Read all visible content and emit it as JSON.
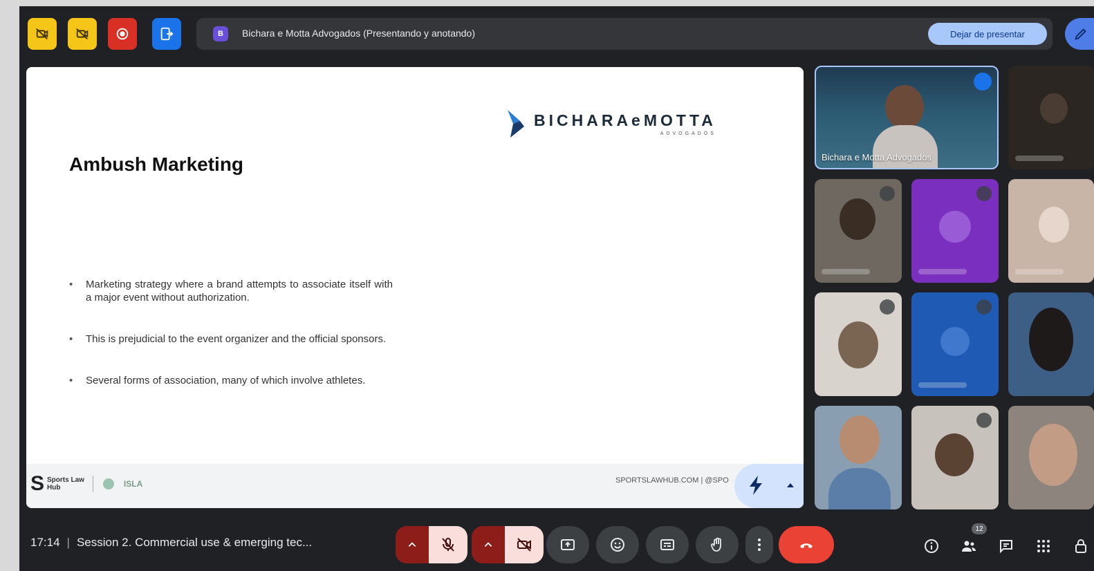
{
  "top_bar": {
    "present_badge": "B",
    "presenting_text": "Bichara e Motta Advogados (Presentando y anotando)",
    "stop_presenting_label": "Dejar de presentar",
    "colors": {
      "yellow": "#f5c518",
      "red": "#d93025",
      "blue": "#1a73e8",
      "stop_btn": "#a8c7fa"
    }
  },
  "slide": {
    "logo_name": "BICHARAeMOTTA",
    "logo_sub": "ADVOGADOS",
    "title": "Ambush Marketing",
    "bullets": [
      "Marketing strategy where a brand attempts to associate itself with a major event without authorization.",
      "This is prejudicial to the event organizer and the official sponsors.",
      "Several forms of association, many of which involve athletes."
    ],
    "footer_brand_line1": "Sports Law",
    "footer_brand_line2": "Hub",
    "footer_partner": "ISLA",
    "footer_url": "SPORTSLAWHUB.COM | @SPO"
  },
  "participants": {
    "main_tile_name": "Bichara e Motta Advogados",
    "count_badge": "12"
  },
  "bottom_bar": {
    "time": "17:14",
    "separator": "|",
    "meeting_title": "Session 2. Commercial use & emerging tec...",
    "end_call_color": "#ea4335"
  }
}
